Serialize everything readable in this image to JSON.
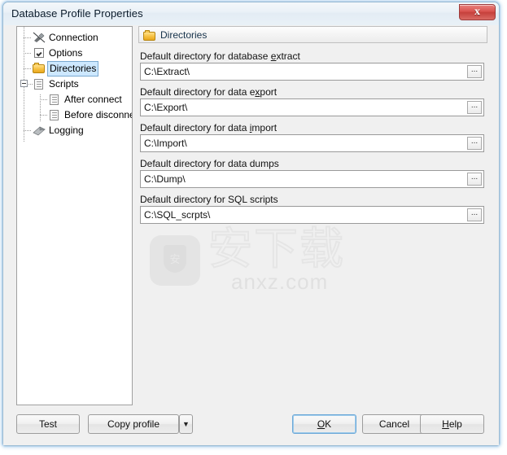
{
  "window": {
    "title": "Database Profile Properties",
    "close_label": "x",
    "close_icon": "close-icon"
  },
  "tree": {
    "items": [
      {
        "label": "Connection",
        "icon": "plug-icon",
        "selected": false,
        "indent": 0
      },
      {
        "label": "Options",
        "icon": "checkbox-icon",
        "selected": false,
        "indent": 0
      },
      {
        "label": "Directories",
        "icon": "folder-icon",
        "selected": true,
        "indent": 0
      },
      {
        "label": "Scripts",
        "icon": "document-icon",
        "selected": false,
        "indent": 0,
        "expanded": true
      },
      {
        "label": "After connect",
        "icon": "document-icon",
        "selected": false,
        "indent": 1
      },
      {
        "label": "Before disconnec",
        "icon": "document-icon",
        "selected": false,
        "indent": 1
      },
      {
        "label": "Logging",
        "icon": "log-icon",
        "selected": false,
        "indent": 0
      }
    ]
  },
  "panel": {
    "header_title": "Directories",
    "header_icon": "folder-icon",
    "fields": [
      {
        "label_before": "Default directory for database ",
        "label_accel": "e",
        "label_after": "xtract",
        "value": "C:\\Extract\\",
        "browse_label": "..."
      },
      {
        "label_before": "Default directory for data e",
        "label_accel": "x",
        "label_after": "port",
        "value": "C:\\Export\\",
        "browse_label": "..."
      },
      {
        "label_before": "Default directory for data ",
        "label_accel": "i",
        "label_after": "mport",
        "value": "C:\\Import\\",
        "browse_label": "..."
      },
      {
        "label_before": "Default directory for data dumps",
        "label_accel": "",
        "label_after": "",
        "value": "C:\\Dump\\",
        "browse_label": "..."
      },
      {
        "label_before": "Default directory for SQL scripts",
        "label_accel": "",
        "label_after": "",
        "value": "C:\\SQL_scrpts\\",
        "browse_label": "..."
      }
    ]
  },
  "watermark": {
    "domain_text": "anxz.com",
    "cjk_text": "安下载",
    "badge_char": "安"
  },
  "footer": {
    "test_label": "Test",
    "copy_profile_label": "Copy profile",
    "copy_profile_arrow": "▼",
    "ok_before": "",
    "ok_accel": "O",
    "ok_after": "K",
    "cancel_label": "Cancel",
    "help_before": "",
    "help_accel": "H",
    "help_after": "elp"
  },
  "colors": {
    "selection": "#cde8ff",
    "accent": "#6ba8d8",
    "close_red": "#c6403c",
    "folder_gold": "#f6bf3f"
  }
}
